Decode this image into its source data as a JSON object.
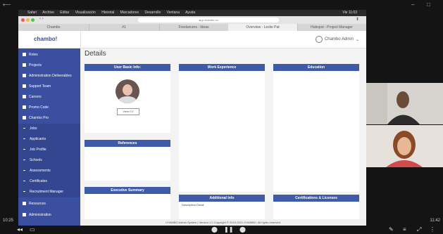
{
  "player": {
    "window_controls": [
      "–",
      "□"
    ],
    "time_left": "10:25",
    "time_right": "11:42"
  },
  "mac_menubar": {
    "items": [
      "Safari",
      "Archivo",
      "Editar",
      "Visualización",
      "Historial",
      "Marcadores",
      "Desarrollo",
      "Ventana",
      "Ayuda"
    ],
    "right": "Vie 11:03"
  },
  "browser": {
    "url": "app.chambo.co",
    "tabs": [
      "Chambo",
      "#1",
      "Freelancers - Ideas",
      "Overview - Leslie Pat",
      "Hubspot - Project Manager"
    ]
  },
  "app": {
    "logo": "chambo!",
    "user_name": "Chambo Admin",
    "page_title": "Details"
  },
  "sidebar": {
    "items": [
      {
        "label": "Roles",
        "icon": "roles-icon"
      },
      {
        "label": "Projects",
        "icon": "projects-icon"
      },
      {
        "label": "Administration Deliverables",
        "icon": "deliverables-icon"
      },
      {
        "label": "Support Team",
        "icon": "support-team-icon"
      },
      {
        "label": "Careers",
        "icon": "careers-icon"
      },
      {
        "label": "Promo Code",
        "icon": "promo-code-icon"
      },
      {
        "label": "Chambo Pro",
        "icon": "chambo-pro-icon"
      }
    ],
    "sub_items": [
      "Jobs",
      "Applicants",
      "Job Profile",
      "Schools",
      "Assessments",
      "Certificates",
      "Recruitment Manager"
    ],
    "bottom_items": [
      "Resources",
      "Administration"
    ]
  },
  "panels": {
    "basic_info": "User Basic Info:",
    "view_cv": "View CV",
    "work_experience": "Work Experience",
    "education": "Education",
    "references": "References",
    "executive_summary": "Executive Summary",
    "additional_info": "Additional Info",
    "additional_info_value": "Description Detail",
    "certifications": "Certifications & Licenses"
  },
  "footer": "CHAMBO Admin System | Version 1.0 Copyright © 2019-2021 CHAMBO. All rights reserved.",
  "meet_controls": {
    "mic_icon": "microphone-icon",
    "camera_icon": "camera-icon",
    "share_icon": "share-icon"
  }
}
